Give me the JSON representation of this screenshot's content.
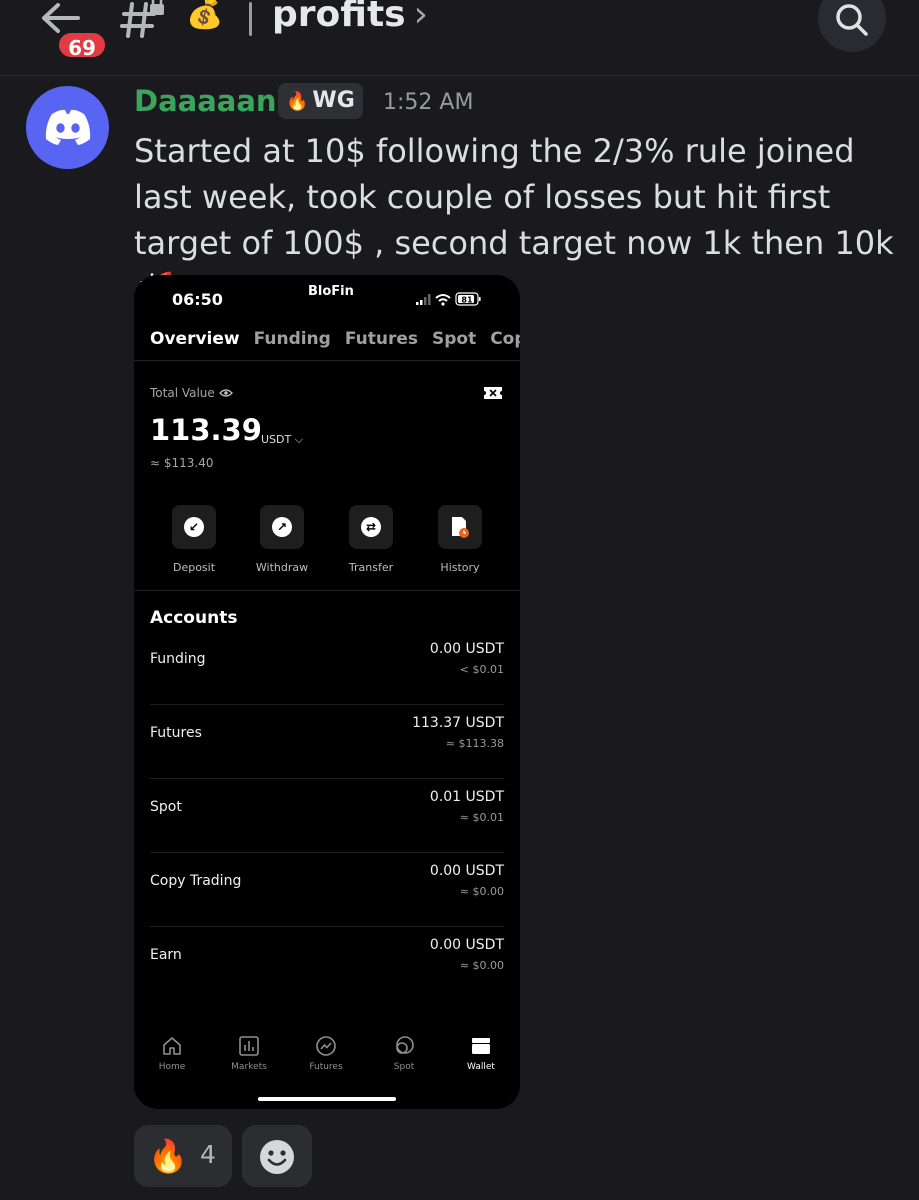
{
  "header": {
    "unread_count": "69",
    "channel_emoji": "💰",
    "channel_name": "profits",
    "chevron": "›"
  },
  "message": {
    "username": "Daaaaann",
    "username_color": "#3ba55d",
    "tag_emoji": "🔥",
    "tag": "WG",
    "time": "1:52 AM",
    "text": "Started at 10$ following the 2/3% rule  joined last week, took couple of losses but hit first target of 100$ , second target now 1k then 10k🚀"
  },
  "phone": {
    "time": "06:50",
    "brand": "BloFin",
    "battery": "81",
    "tabs": [
      "Overview",
      "Funding",
      "Futures",
      "Spot",
      "Copy"
    ],
    "total_value_label": "Total Value",
    "total_value": "113.39",
    "unit": "USDT ⌵",
    "total_usd": "≈ $113.40",
    "actions": [
      {
        "label": "Deposit",
        "icon": "deposit-icon"
      },
      {
        "label": "Withdraw",
        "icon": "withdraw-icon"
      },
      {
        "label": "Transfer",
        "icon": "transfer-icon"
      },
      {
        "label": "History",
        "icon": "history-icon"
      }
    ],
    "accounts_title": "Accounts",
    "accounts": [
      {
        "name": "Funding",
        "amount": "0.00 USDT",
        "usd": "< $0.01"
      },
      {
        "name": "Futures",
        "amount": "113.37 USDT",
        "usd": "≈ $113.38"
      },
      {
        "name": "Spot",
        "amount": "0.01 USDT",
        "usd": "≈ $0.01"
      },
      {
        "name": "Copy Trading",
        "amount": "0.00 USDT",
        "usd": "≈ $0.00"
      },
      {
        "name": "Earn",
        "amount": "0.00 USDT",
        "usd": "≈ $0.00"
      }
    ],
    "nav": [
      {
        "label": "Home",
        "icon": "home-icon"
      },
      {
        "label": "Markets",
        "icon": "markets-icon"
      },
      {
        "label": "Futures",
        "icon": "futures-icon"
      },
      {
        "label": "Spot",
        "icon": "spot-icon"
      },
      {
        "label": "Wallet",
        "icon": "wallet-icon",
        "active": true
      }
    ]
  },
  "reactions": {
    "fire_emoji": "🔥",
    "fire_count": "4"
  }
}
